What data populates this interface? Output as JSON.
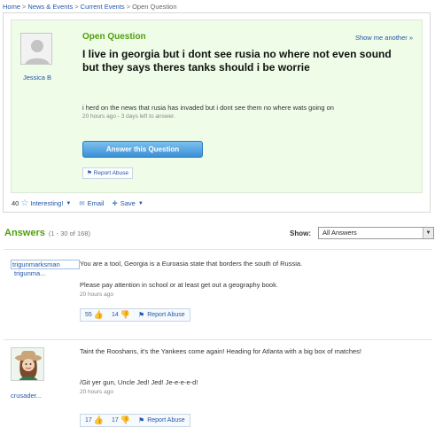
{
  "breadcrumb": {
    "home": "Home",
    "news": "News & Events",
    "current": "Current Events",
    "page": "Open Question",
    "sep": ">"
  },
  "question": {
    "label": "Open Question",
    "show_another": "Show me another »",
    "asker": "Jessica B",
    "title": "I live in georgia but i dont see rusia no where not even sound but they says theres tanks should i be worrie",
    "body": "i herd on the news that rusia has invaded but i dont see them no where wats going on",
    "meta": "20 hours ago - 3 days left to answer.",
    "answer_button": "Answer this Question",
    "report_abuse": "Report Abuse"
  },
  "question_footer": {
    "count": "40",
    "interesting": "Interesting!",
    "email": "Email",
    "save": "Save"
  },
  "answers_header": {
    "title": "Answers",
    "range": "(1 - 30 of 168)",
    "show_label": "Show:",
    "show_value": "All Answers"
  },
  "answers": [
    {
      "user_full": "trigunmarksman",
      "user_short": "trigunma...",
      "paragraphs": [
        "You are a tool, Georgia is a Euroasia state that borders the south of Russia.",
        "Please pay attention in school or at least get out a geography book."
      ],
      "meta": "20 hours ago",
      "thumbs_up": "55",
      "thumbs_down": "14",
      "report": "Report Abuse"
    },
    {
      "user_short": "crusader...",
      "paragraphs": [
        "Taint the Rooshans, it's the Yankees come again! Heading for Atlanta with a big box of matches!",
        "/Git yer gun, Uncle Jed! Jed! Je-e-e-e-d!"
      ],
      "meta": "20 hours ago",
      "thumbs_up": "17",
      "thumbs_down": "17",
      "report": "Report Abuse"
    }
  ],
  "icons": {
    "star": "star-icon",
    "email": "envelope-icon",
    "save": "plus-icon",
    "thumb_up": "thumbs-up-icon",
    "thumb_down": "thumbs-down-icon",
    "flag": "flag-icon"
  },
  "colors": {
    "accent_green": "#4f9f0d",
    "link_blue": "#2255aa",
    "question_bg": "#eefce8",
    "button_blue": "#3b90d6"
  }
}
